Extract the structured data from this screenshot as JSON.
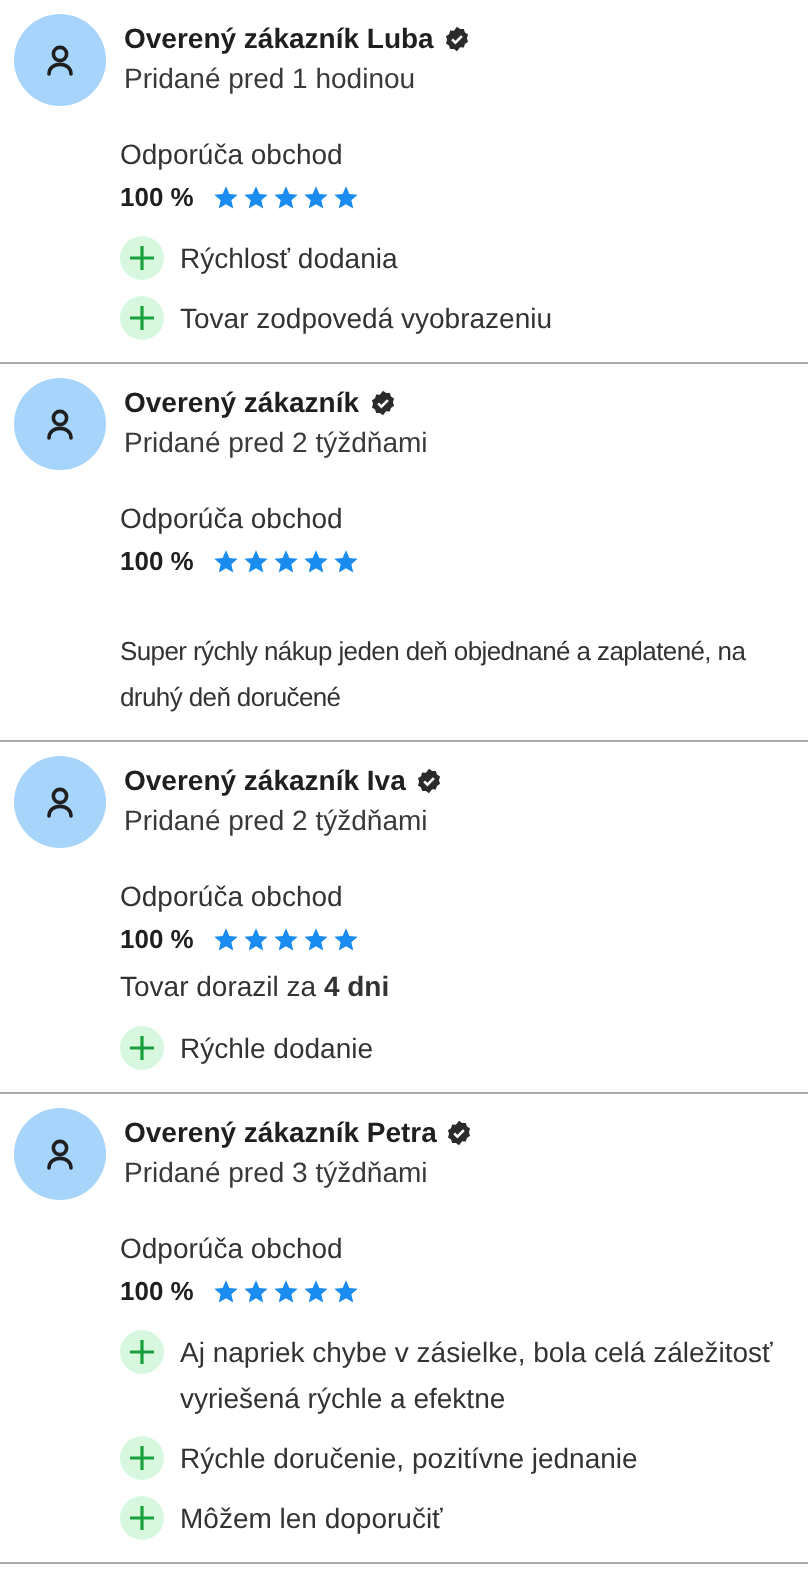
{
  "reviews": [
    {
      "author": "Overený zákazník Luba",
      "verified": true,
      "added": "Pridané pred 1 hodinou",
      "recommends": "Odporúča obchod",
      "percent": "100 %",
      "stars": 5,
      "pros": [
        "Rýchlosť dodania",
        "Tovar zodpovedá vyobrazeniu"
      ]
    },
    {
      "author": "Overený zákazník",
      "verified": true,
      "added": "Pridané pred 2 týždňami",
      "recommends": "Odporúča obchod",
      "percent": "100 %",
      "stars": 5,
      "comment": "Super rýchly nákup jeden deň objednané a zaplatené, na druhý deň doručené"
    },
    {
      "author": "Overený zákazník Iva",
      "verified": true,
      "added": "Pridané pred 2 týždňami",
      "recommends": "Odporúča obchod",
      "percent": "100 %",
      "stars": 5,
      "delivery_note": "Tovar dorazil za **4 dni**",
      "pros": [
        "Rýchle dodanie"
      ]
    },
    {
      "author": "Overený zákazník Petra",
      "verified": true,
      "added": "Pridané pred 3 týždňami",
      "recommends": "Odporúča obchod",
      "percent": "100 %",
      "stars": 5,
      "pros": [
        "Aj napriek chybe v zásielke, bola celá záležitosť vyriešená rýchle a efektne",
        "Rýchle doručenie, pozitívne jednanie",
        "Môžem len doporučiť"
      ]
    }
  ]
}
